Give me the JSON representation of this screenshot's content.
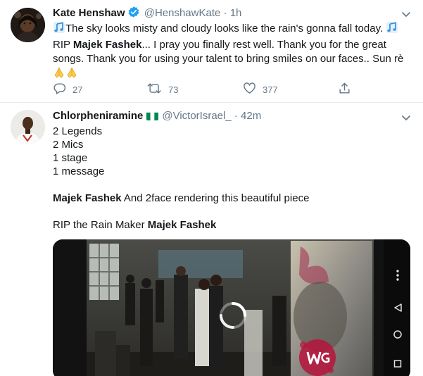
{
  "tweet1": {
    "name": "Kate Henshaw",
    "handle": "@HenshawKate",
    "separator": "·",
    "time": "1h",
    "text_line1": "The sky looks misty and cloudy looks like the rain's gonna fall today.",
    "text_rip": "RIP",
    "text_bold": "Majek Fashek",
    "text_rest": "... I pray you finally rest well. Thank you for the great songs. Thank you for using your talent to bring smiles on our faces.. Sun rè",
    "replies": "27",
    "retweets": "73",
    "likes": "377"
  },
  "tweet2": {
    "name": "Chlorpheniramine",
    "handle": "@VictorIsrael_",
    "separator": "·",
    "time": "42m",
    "lines": [
      "2 Legends",
      "2 Mics",
      "1 stage",
      "1 message"
    ],
    "line5_bold": "Majek Fashek",
    "line5_rest": "And 2face rendering this beautiful piece",
    "line6_plain": "RIP the Rain Maker",
    "line6_bold": "Majek Fashek"
  },
  "colors": {
    "twitter_blue": "#1da1f2",
    "muted": "#657786",
    "flag_green": "#008751"
  },
  "icons": [
    "music-note-icon",
    "praying-hands-icon",
    "verified-badge-icon",
    "nigeria-flag-icon",
    "caret-down-icon",
    "reply-icon",
    "retweet-icon",
    "like-icon",
    "share-icon",
    "loading-spinner-icon"
  ]
}
